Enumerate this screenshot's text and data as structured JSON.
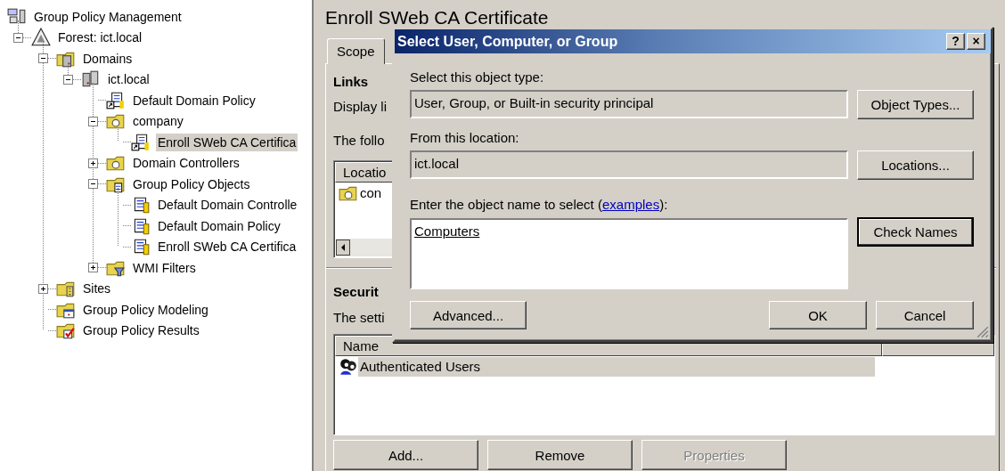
{
  "tree": [
    {
      "label": "Group Policy Management",
      "kind": "console",
      "selected": false,
      "children": [
        {
          "label": "Forest: ict.local",
          "kind": "forest",
          "expanded": true,
          "selected": false,
          "children": [
            {
              "label": "Domains",
              "kind": "domains",
              "expanded": true,
              "selected": false,
              "children": [
                {
                  "label": "ict.local",
                  "kind": "domain",
                  "expanded": true,
                  "selected": false,
                  "children": [
                    {
                      "label": "Default Domain Policy",
                      "kind": "gpo-link",
                      "selected": false
                    },
                    {
                      "label": "company",
                      "kind": "ou",
                      "expanded": true,
                      "selected": false,
                      "children": [
                        {
                          "label": "Enroll SWeb CA Certifica",
                          "kind": "gpo-link",
                          "selected": true
                        }
                      ]
                    },
                    {
                      "label": "Domain Controllers",
                      "kind": "ou",
                      "expanded": false,
                      "selected": false
                    },
                    {
                      "label": "Group Policy Objects",
                      "kind": "gpo-folder",
                      "expanded": true,
                      "selected": false,
                      "children": [
                        {
                          "label": "Default Domain Controlle",
                          "kind": "gpo",
                          "selected": false
                        },
                        {
                          "label": "Default Domain Policy",
                          "kind": "gpo",
                          "selected": false
                        },
                        {
                          "label": "Enroll SWeb CA Certifica",
                          "kind": "gpo",
                          "selected": false
                        }
                      ]
                    },
                    {
                      "label": "WMI Filters",
                      "kind": "wmi",
                      "expanded": false,
                      "selected": false
                    }
                  ]
                }
              ]
            },
            {
              "label": "Sites",
              "kind": "sites",
              "expanded": false,
              "selected": false
            },
            {
              "label": "Group Policy Modeling",
              "kind": "modeling",
              "selected": false
            },
            {
              "label": "Group Policy Results",
              "kind": "results",
              "selected": false
            }
          ]
        }
      ]
    }
  ],
  "panel": {
    "title": "Enroll SWeb CA Certificate",
    "tabs": [
      {
        "label": "Scope",
        "selected": true
      }
    ],
    "links_heading": "Links",
    "display_label": "Display li",
    "following_label": "The follo",
    "links_list": {
      "columns": [
        "Locatio"
      ],
      "rows": [
        {
          "label": "con",
          "kind": "ou"
        }
      ]
    },
    "security_heading": "Securit",
    "settings_label": "The setti",
    "security_list": {
      "columns": [
        "Name"
      ],
      "rows": [
        {
          "label": "Authenticated Users",
          "kind": "users",
          "selected": true
        }
      ]
    },
    "buttons": [
      {
        "label": "Add...",
        "disabled": false
      },
      {
        "label": "Remove",
        "disabled": false
      },
      {
        "label": "Properties",
        "disabled": true
      }
    ]
  },
  "dialog": {
    "title": "Select User, Computer, or Group",
    "title_buttons": [
      "?",
      "×"
    ],
    "object_type": {
      "label": "Select this object type:",
      "value": "User, Group, or Built-in security principal",
      "button": {
        "label": "Object Types...",
        "default": false
      }
    },
    "location": {
      "label": "From this location:",
      "value": "ict.local",
      "button": {
        "label": "Locations...",
        "default": false
      }
    },
    "names": {
      "prompt_before": "Enter the object name to select (",
      "link": "examples",
      "prompt_after": "):",
      "value": "Computers",
      "resolved": true,
      "button": {
        "label": "Check Names",
        "default": true
      }
    },
    "buttons": [
      {
        "label": "Advanced...",
        "default": false
      },
      {
        "label": "OK",
        "default": false
      },
      {
        "label": "Cancel",
        "default": false
      }
    ]
  }
}
